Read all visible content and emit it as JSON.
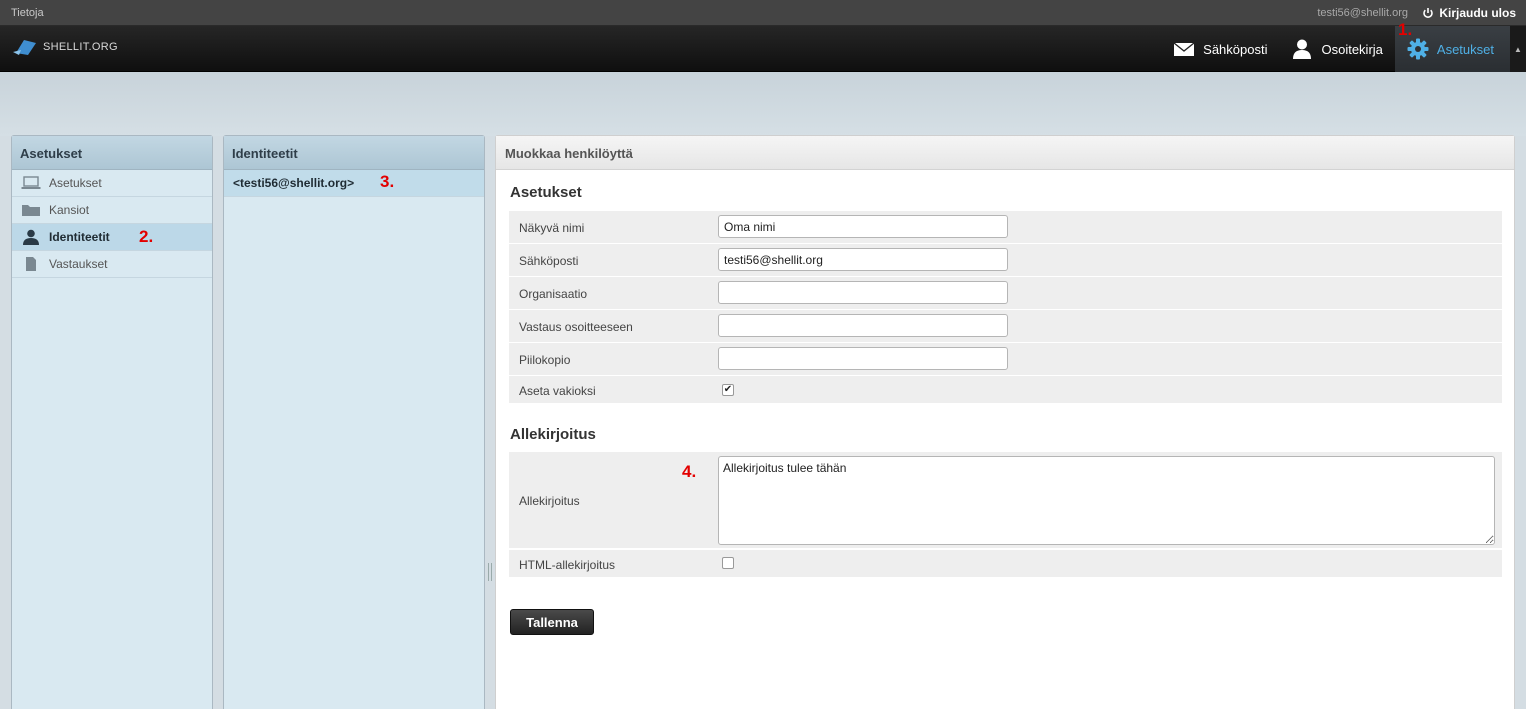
{
  "topbar": {
    "about_label": "Tietoja",
    "user_email": "testi56@shellit.org",
    "logout_label": "Kirjaudu ulos"
  },
  "header": {
    "logo_text": "SHELLIT.ORG",
    "nav": [
      {
        "label": "Sähköposti",
        "icon": "envelope-icon"
      },
      {
        "label": "Osoitekirja",
        "icon": "person-icon"
      },
      {
        "label": "Asetukset",
        "icon": "gear-icon",
        "active": true
      }
    ]
  },
  "markers": [
    "1.",
    "2.",
    "3.",
    "4."
  ],
  "settings_panel": {
    "title": "Asetukset",
    "items": [
      {
        "label": "Asetukset",
        "icon": "laptop-icon"
      },
      {
        "label": "Kansiot",
        "icon": "folder-icon"
      },
      {
        "label": "Identiteetit",
        "icon": "identity-icon",
        "active": true
      },
      {
        "label": "Vastaukset",
        "icon": "document-icon"
      }
    ]
  },
  "identities_panel": {
    "title": "Identiteetit",
    "items": [
      "<testi56@shellit.org>"
    ]
  },
  "edit_panel": {
    "title": "Muokkaa henkilöyttä",
    "section_settings": "Asetukset",
    "fields": {
      "display_name": {
        "label": "Näkyvä nimi",
        "value": "Oma nimi"
      },
      "email": {
        "label": "Sähköposti",
        "value": "testi56@shellit.org"
      },
      "organization": {
        "label": "Organisaatio",
        "value": ""
      },
      "reply_to": {
        "label": "Vastaus osoitteeseen",
        "value": ""
      },
      "bcc": {
        "label": "Piilokopio",
        "value": ""
      },
      "set_default": {
        "label": "Aseta vakioksi",
        "checked": true
      }
    },
    "section_signature": "Allekirjoitus",
    "signature": {
      "label": "Allekirjoitus",
      "value": "Allekirjoitus tulee tähän"
    },
    "html_signature": {
      "label": "HTML-allekirjoitus",
      "checked": false
    },
    "save_label": "Tallenna"
  }
}
